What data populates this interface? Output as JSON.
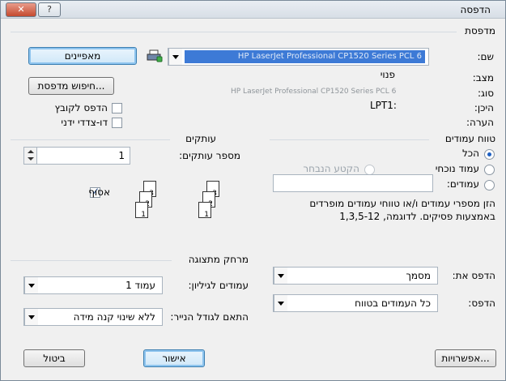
{
  "window": {
    "title": "הדפסה",
    "help_label": "?",
    "close_label": "✕"
  },
  "printer": {
    "group_label": "מדפסת",
    "name_label": "שם:",
    "name_value": "HP LaserJet Professional CP1520 Series PCL 6",
    "status_label": "מצב:",
    "status_value": "פנוי",
    "type_label": "סוג:",
    "type_value": "HP LaserJet Professional CP1520 Series PCL 6",
    "where_label": "היכן:",
    "where_value": "LPT1:",
    "comment_label": "הערה:",
    "properties_button": "מאפיינים",
    "find_printer_button": "חיפוש מדפסת...",
    "print_to_file_label": "הדפס לקובץ",
    "print_to_file_checked": false,
    "duplex_label": "דו-צדדי ידני",
    "duplex_checked": false
  },
  "page_range": {
    "group_label": "טווח עמודים",
    "all_label": "הכל",
    "current_label": "עמוד נוכחי",
    "selection_label": "הקטע הנבחר",
    "pages_label": "עמודים:",
    "pages_value": "",
    "help_text": "הזן מספרי עמודים ו/או טווחי עמודים מופרדים באמצעות פסיקים. לדוגמה, 1,3,5-12",
    "selected": "all"
  },
  "copies": {
    "group_label": "עותקים",
    "count_label": "מספר עותקים:",
    "count_value": "1",
    "collate_label": "אסוף",
    "collate_checked": true,
    "page_numbers": [
      "1",
      "2",
      "3"
    ]
  },
  "print_what": {
    "label": "הדפס את:",
    "value": "מסמך"
  },
  "print": {
    "label": "הדפס:",
    "value": "כל העמודים בטווח"
  },
  "zoom": {
    "group_label": "מרחק מתצוגה",
    "pages_per_sheet_label": "עמודים לגיליון:",
    "pages_per_sheet_value": "1 עמוד",
    "scale_label": "התאם לגודל הנייר:",
    "scale_value": "ללא שינוי קנה מידה"
  },
  "footer": {
    "options_button": "אפשרויות...",
    "ok_button": "אישור",
    "cancel_button": "ביטול"
  }
}
